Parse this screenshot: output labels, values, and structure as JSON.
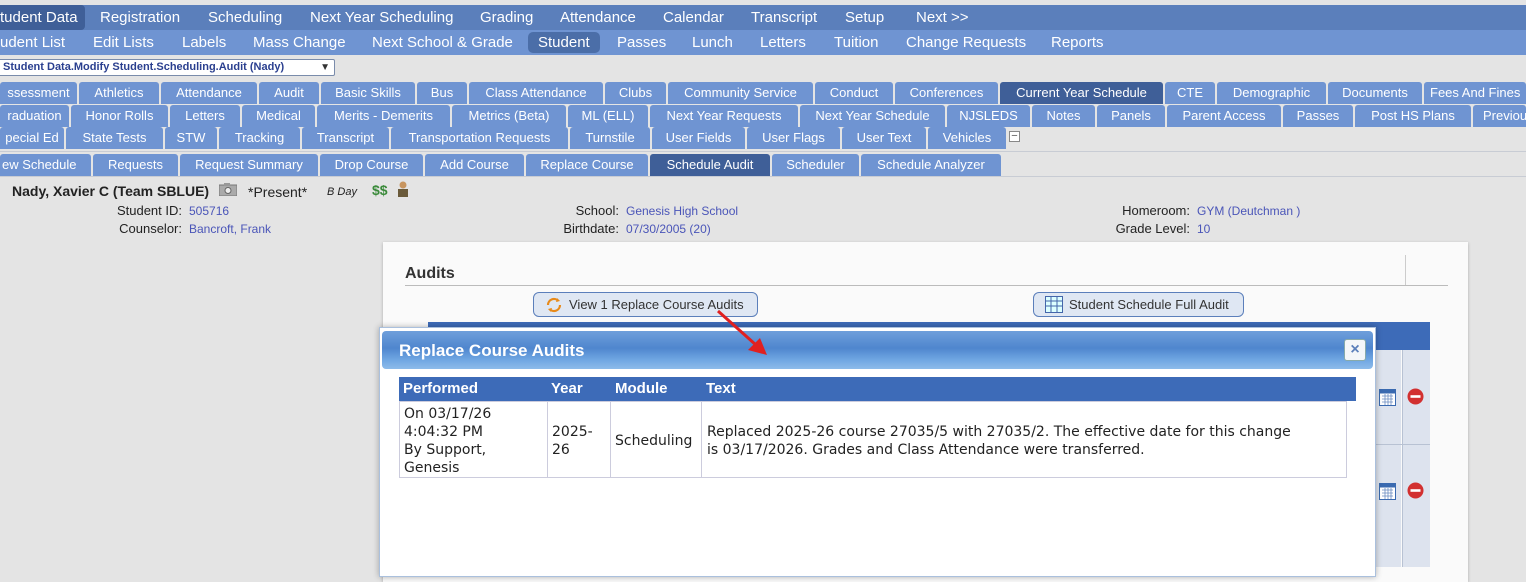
{
  "top_nav": {
    "items": [
      "tudent Data",
      "Registration",
      "Scheduling",
      "Next Year Scheduling",
      "Grading",
      "Attendance",
      "Calendar",
      "Transcript",
      "Setup",
      "Next >>"
    ]
  },
  "sub_nav": {
    "items": [
      "udent List",
      "Edit Lists",
      "Labels",
      "Mass Change",
      "Next School & Grade",
      "Student",
      "Passes",
      "Lunch",
      "Letters",
      "Tuition",
      "Change Requests",
      "Reports"
    ]
  },
  "profile_select": {
    "value": "Student Data.Modify Student.Scheduling.Audit (Nady)"
  },
  "tabs_row1": [
    "ssessment",
    "Athletics",
    "Attendance",
    "Audit",
    "Basic Skills",
    "Bus",
    "Class Attendance",
    "Clubs",
    "Community Service",
    "Conduct",
    "Conferences",
    "Current Year Schedule",
    "CTE",
    "Demographic",
    "Documents",
    "Fees And Fines"
  ],
  "tabs_row2": [
    "raduation",
    "Honor Rolls",
    "Letters",
    "Medical",
    "Merits - Demerits",
    "Metrics (Beta)",
    "ML (ELL)",
    "Next Year Requests",
    "Next Year Schedule",
    "NJSLEDS",
    "Notes",
    "Panels",
    "Parent Access",
    "Passes",
    "Post HS Plans",
    "Previous"
  ],
  "tabs_row3": [
    "pecial Ed",
    "State Tests",
    "STW",
    "Tracking",
    "Transcript",
    "Transportation Requests",
    "Turnstile",
    "User Fields",
    "User Flags",
    "User Text",
    "Vehicles"
  ],
  "tabs_row4": [
    "ew Schedule",
    "Requests",
    "Request Summary",
    "Drop Course",
    "Add Course",
    "Replace Course",
    "Schedule Audit",
    "Scheduler",
    "Schedule Analyzer"
  ],
  "student": {
    "name": "Nady, Xavier C (Team SBLUE)",
    "status": "*Present*",
    "day": "B Day",
    "id_label": "Student ID:",
    "id": "505716",
    "counselor_label": "Counselor:",
    "counselor": "Bancroft, Frank",
    "school_label": "School:",
    "school": "Genesis High School",
    "birthdate_label": "Birthdate:",
    "birthdate": "07/30/2005 (20)",
    "homeroom_label": "Homeroom:",
    "homeroom": "GYM (Deutchman )",
    "grade_label": "Grade Level:",
    "grade": "10"
  },
  "audits": {
    "title": "Audits",
    "view_button": "View 1 Replace Course Audits",
    "full_audit_button": "Student Schedule Full Audit"
  },
  "modal": {
    "title": "Replace Course Audits",
    "columns": [
      "Performed",
      "Year",
      "Module",
      "Text"
    ],
    "row": {
      "performed": [
        "On 03/17/26",
        "4:04:32 PM",
        "By Support,",
        "Genesis"
      ],
      "year": [
        "2025-",
        "26"
      ],
      "module": "Scheduling",
      "text": [
        "Replaced 2025-26 course 27035/5 with 27035/2. The effective date for this change",
        "is 03/17/2026. Grades and Class Attendance were transferred."
      ]
    }
  },
  "colors": {
    "nav_dark": "#5b7fbb",
    "nav_light": "#6f94d2",
    "header_blue": "#3d6bb8",
    "link": "#4a55b8",
    "arrow": "#e02020"
  }
}
